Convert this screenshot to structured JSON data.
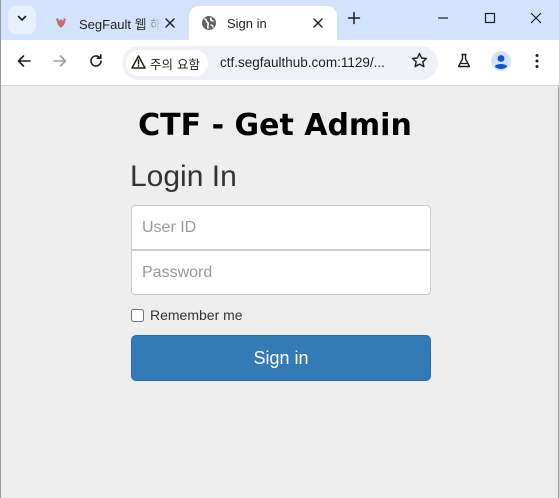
{
  "browser": {
    "tabs": [
      {
        "title": "SegFault 웹 해킹",
        "favicon": "segfault-logo-icon",
        "active": false
      },
      {
        "title": "Sign in",
        "favicon": "globe-icon",
        "active": true
      }
    ],
    "address_bar": {
      "security_label": "주의 요함",
      "url": "ctf.segfaulthub.com:1129/..."
    },
    "icons": {
      "tab_search": "chevron-down-icon",
      "new_tab": "plus-icon",
      "back": "back-arrow-icon",
      "forward": "forward-arrow-icon",
      "reload": "reload-icon",
      "warning": "warning-triangle-icon",
      "bookmark": "star-icon",
      "labs": "flask-icon",
      "profile": "profile-icon",
      "menu": "kebab-menu-icon"
    },
    "colors": {
      "tabstrip": "#d3e3fd",
      "profile_accent": "#0b57d0"
    }
  },
  "page": {
    "heading": "CTF - Get Admin",
    "form": {
      "title": "Login In",
      "user_placeholder": "User ID",
      "password_placeholder": "Password",
      "remember_label": "Remember me",
      "remember_checked": false,
      "submit_label": "Sign in"
    },
    "colors": {
      "background": "#eeeeee",
      "button": "#337ab7"
    }
  }
}
